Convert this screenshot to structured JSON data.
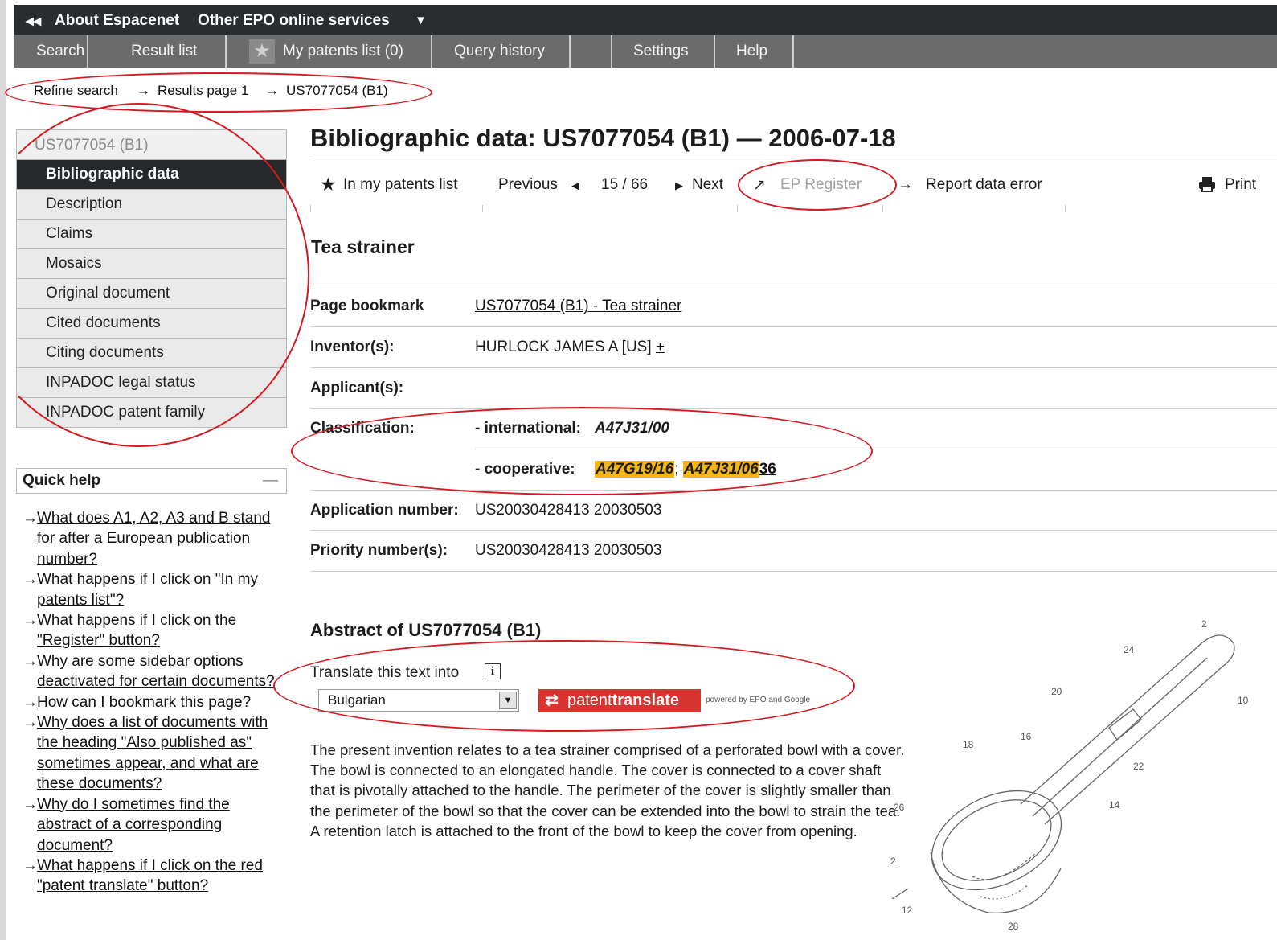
{
  "topbar": {
    "back": "◂◂",
    "about": "About Espacenet",
    "other": "Other EPO online services",
    "caret": "▼"
  },
  "nav": {
    "search": "Search",
    "result_list": "Result list",
    "my_patents": "My patents list (0)",
    "query_history": "Query history",
    "settings": "Settings",
    "help": "Help"
  },
  "breadcrumb": {
    "refine": "Refine search",
    "arrow": "→",
    "results": "Results page 1",
    "current": "US7077054 (B1)"
  },
  "sidebar": {
    "header": "US7077054  (B1)",
    "items": [
      "Bibliographic data",
      "Description",
      "Claims",
      "Mosaics",
      "Original document",
      "Cited documents",
      "Citing documents",
      "INPADOC legal status",
      "INPADOC patent family"
    ]
  },
  "quick_help": {
    "title": "Quick help",
    "collapse": "—",
    "items": [
      "What does A1, A2, A3 and B stand for after a European publication number?",
      "What happens if I click on \"In my patents list\"?",
      "What happens if I click on the \"Register\" button?",
      "Why are some sidebar options deactivated for certain documents?",
      "How can I bookmark this page?",
      "Why does a list of documents with the heading \"Also published as\" sometimes appear, and what are these documents?",
      "Why do I sometimes find the abstract of a corresponding document?",
      "What happens if I click on the red \"patent translate\" button?"
    ]
  },
  "main": {
    "title": "Bibliographic data: US7077054  (B1) — 2006-07-18",
    "toolbar": {
      "in_list": "In my patents list",
      "previous": "Previous",
      "position": "15 / 66",
      "next": "Next",
      "ep_register": "EP Register",
      "report": "Report data error",
      "print": "Print"
    },
    "invention_title": "Tea strainer",
    "rows": {
      "bookmark_label": "Page bookmark",
      "bookmark_value": "US7077054  (B1)  -  Tea strainer",
      "inventor_label": "Inventor(s):",
      "inventor_value": "HURLOCK JAMES A [US]",
      "inventor_more": "+",
      "applicant_label": "Applicant(s):",
      "class_label": "Classification:",
      "intl_label": "- international:",
      "intl_value": "A47J31/00",
      "coop_label": "- cooperative:",
      "coop_1": "A47G19/16",
      "coop_sep": ";",
      "coop_2": "A47J31/06",
      "coop_3": "36",
      "appno_label": "Application number:",
      "appno_value": "US20030428413 20030503",
      "prio_label": "Priority number(s):",
      "prio_value": "US20030428413 20030503"
    },
    "abstract_title": "Abstract of  US7077054  (B1)",
    "translate_label": "Translate this text into",
    "translate_info": "i",
    "language": "Bulgarian",
    "pt_logo_a": "patent",
    "pt_logo_b": "translate",
    "pt_powered": "powered by EPO and Google",
    "abstract_text": "The present invention relates to a tea strainer comprised of a perforated bowl with a cover. The bowl is connected to an elongated handle. The cover is connected to a cover shaft that is pivotally attached to the handle. The perimeter of the cover is slightly smaller than the perimeter of the bowl so that the cover can be extended into the bowl to strain the tea. A retention latch is attached to the front of the bowl to keep the cover from opening.",
    "drawing_labels": [
      "2",
      "24",
      "20",
      "10",
      "22",
      "14",
      "18",
      "16",
      "26",
      "2",
      "12",
      "28"
    ]
  }
}
